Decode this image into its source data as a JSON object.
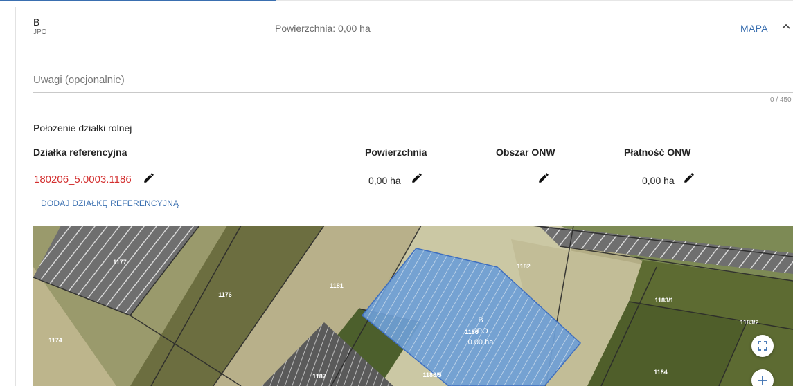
{
  "header": {
    "parcel_letter": "B",
    "parcel_type": "JPO",
    "area_summary": "Powierzchnia: 0,00 ha",
    "map_link": "MAPA"
  },
  "notes": {
    "placeholder": "Uwagi (opcjonalnie)",
    "value": "",
    "counter": "0 / 450"
  },
  "location": {
    "title": "Położenie działki rolnej",
    "columns": [
      "Działka referencyjna",
      "Powierzchnia",
      "Obszar ONW",
      "Płatność ONW"
    ],
    "row": {
      "ref_parcel": "180206_5.0003.1186",
      "area": "0,00 ha",
      "onw_area": "",
      "onw_payment": "0,00 ha"
    },
    "add_button": "DODAJ DZIAŁKĘ REFERENCYJNĄ"
  },
  "map": {
    "parcel_labels": [
      "1177",
      "1176",
      "1174",
      "1181",
      "1182",
      "1183/1",
      "1183/2",
      "1184",
      "1187",
      "1188/5",
      "1186"
    ],
    "selected": {
      "letter": "B",
      "type": "JPO",
      "area": "0.00 ha"
    },
    "controls": {
      "fullscreen_icon": "fullscreen-icon",
      "zoom_in_icon": "plus-icon"
    },
    "colors": {
      "selection_fill": "#6ea0d8",
      "selection_stroke": "#3f6fbf"
    }
  }
}
